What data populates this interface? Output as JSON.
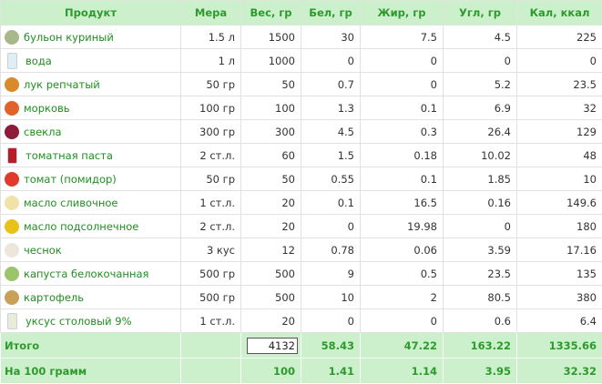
{
  "headers": [
    "Продукт",
    "Мера",
    "Вес, гр",
    "Бел, гр",
    "Жир, гр",
    "Угл, гр",
    "Кал, ккал"
  ],
  "rows": [
    {
      "name": "бульон куриный",
      "icon": "broth-icon",
      "color": "#a8b88a",
      "measure": "1.5 л",
      "weight": "1500",
      "protein": "30",
      "fat": "7.5",
      "carbs": "4.5",
      "kcal": "225"
    },
    {
      "name": "вода",
      "icon": "water-glass-icon",
      "color": "#dfeef5",
      "measure": "1 л",
      "weight": "1000",
      "protein": "0",
      "fat": "0",
      "carbs": "0",
      "kcal": "0"
    },
    {
      "name": "лук репчатый",
      "icon": "onion-icon",
      "color": "#d98a2b",
      "measure": "50 гр",
      "weight": "50",
      "protein": "0.7",
      "fat": "0",
      "carbs": "5.2",
      "kcal": "23.5"
    },
    {
      "name": "морковь",
      "icon": "carrot-icon",
      "color": "#e0632a",
      "measure": "100 гр",
      "weight": "100",
      "protein": "1.3",
      "fat": "0.1",
      "carbs": "6.9",
      "kcal": "32"
    },
    {
      "name": "свекла",
      "icon": "beet-icon",
      "color": "#8e1c3a",
      "measure": "300 гр",
      "weight": "300",
      "protein": "4.5",
      "fat": "0.3",
      "carbs": "26.4",
      "kcal": "129"
    },
    {
      "name": "томатная паста",
      "icon": "tomato-paste-icon",
      "color": "#b3202a",
      "measure": "2 ст.л.",
      "weight": "60",
      "protein": "1.5",
      "fat": "0.18",
      "carbs": "10.02",
      "kcal": "48"
    },
    {
      "name": "томат (помидор)",
      "icon": "tomato-icon",
      "color": "#e03a2a",
      "measure": "50 гр",
      "weight": "50",
      "protein": "0.55",
      "fat": "0.1",
      "carbs": "1.85",
      "kcal": "10"
    },
    {
      "name": "масло сливочное",
      "icon": "butter-icon",
      "color": "#f1e3a8",
      "measure": "1 ст.л.",
      "weight": "20",
      "protein": "0.1",
      "fat": "16.5",
      "carbs": "0.16",
      "kcal": "149.6"
    },
    {
      "name": "масло подсолнечное",
      "icon": "sunflower-oil-icon",
      "color": "#e8c11a",
      "measure": "2 ст.л.",
      "weight": "20",
      "protein": "0",
      "fat": "19.98",
      "carbs": "0",
      "kcal": "180"
    },
    {
      "name": "чеснок",
      "icon": "garlic-icon",
      "color": "#ece6dc",
      "measure": "3 кус",
      "weight": "12",
      "protein": "0.78",
      "fat": "0.06",
      "carbs": "3.59",
      "kcal": "17.16"
    },
    {
      "name": "капуста белокочанная",
      "icon": "cabbage-icon",
      "color": "#9cc46a",
      "measure": "500 гр",
      "weight": "500",
      "protein": "9",
      "fat": "0.5",
      "carbs": "23.5",
      "kcal": "135"
    },
    {
      "name": "картофель",
      "icon": "potato-icon",
      "color": "#c9a05a",
      "measure": "500 гр",
      "weight": "500",
      "protein": "10",
      "fat": "2",
      "carbs": "80.5",
      "kcal": "380"
    },
    {
      "name": "уксус столовый 9%",
      "icon": "vinegar-icon",
      "color": "#e8ecd8",
      "measure": "1 ст.л.",
      "weight": "20",
      "protein": "0",
      "fat": "0",
      "carbs": "0.6",
      "kcal": "6.4"
    }
  ],
  "total": {
    "label": "Итого",
    "weight": "4132",
    "protein": "58.43",
    "fat": "47.22",
    "carbs": "163.22",
    "kcal": "1335.66"
  },
  "per100": {
    "label": "На 100 грамм",
    "weight": "100",
    "protein": "1.41",
    "fat": "1.14",
    "carbs": "3.95",
    "kcal": "32.32"
  }
}
